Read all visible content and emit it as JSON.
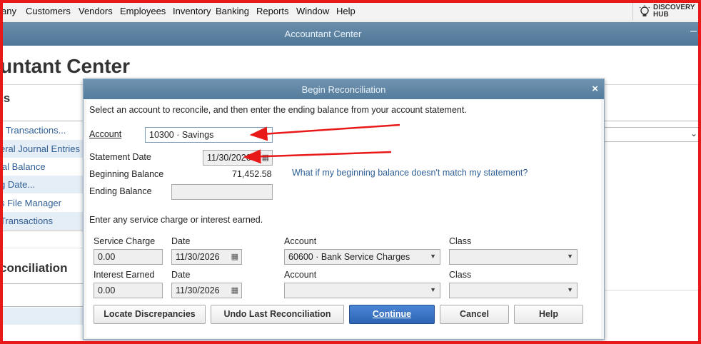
{
  "menu": [
    "any",
    "Customers",
    "Vendors",
    "Employees",
    "Inventory",
    "Banking",
    "Reports",
    "Window",
    "Help"
  ],
  "discovery_hub": {
    "line1": "DISCOVERY",
    "line2": "HUB"
  },
  "window_title": "Accountant Center",
  "page": {
    "title": "untant Center",
    "section_tools": "ls",
    "links": [
      "r Transactions...",
      "eral Journal Entries",
      "ial Balance",
      "g Date...",
      "s File Manager",
      " Transactions"
    ],
    "section_recon": "conciliation"
  },
  "dialog": {
    "title": "Begin Reconciliation",
    "instruction": "Select an account to reconcile, and then enter the ending balance from your account statement.",
    "account_label": "Account",
    "account_value": "10300 · Savings",
    "statement_date_label": "Statement Date",
    "statement_date_value": "11/30/2026",
    "beginning_balance_label": "Beginning Balance",
    "beginning_balance_value": "71,452.58",
    "beginning_balance_link": "What if my beginning balance doesn't match my statement?",
    "ending_balance_label": "Ending Balance",
    "ending_balance_value": "",
    "service_instruction": "Enter any service charge or interest earned.",
    "col_date": "Date",
    "col_account": "Account",
    "col_class": "Class",
    "service_charge_label": "Service Charge",
    "service_charge_value": "0.00",
    "service_date": "11/30/2026",
    "service_account": "60600 · Bank Service Charges",
    "service_class": "",
    "interest_label": "Interest Earned",
    "interest_value": "0.00",
    "interest_date": "11/30/2026",
    "interest_account": "",
    "interest_class": "",
    "buttons": {
      "locate": "Locate Discrepancies",
      "undo": "Undo Last Reconciliation",
      "continue": "Continue",
      "cancel": "Cancel",
      "help": "Help"
    }
  },
  "colors": {
    "annotation": "#e81919",
    "title_bar": "#557c9c",
    "link": "#2f5f96",
    "primary_button": "#2d64b4"
  }
}
